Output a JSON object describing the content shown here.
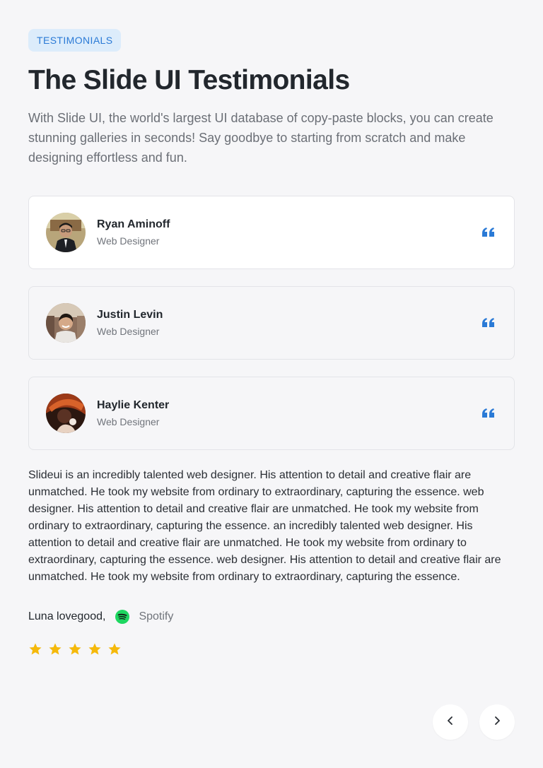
{
  "header": {
    "badge": "TESTIMONIALS",
    "title": "The Slide UI Testimonials",
    "description": "With Slide UI, the world's largest UI database of copy-paste blocks, you can create stunning galleries in seconds! Say goodbye to starting from scratch and make designing effortless and fun."
  },
  "testimonials": [
    {
      "name": "Ryan Aminoff",
      "role": "Web Designer",
      "avatar_icon": "person-avatar-1",
      "active": true
    },
    {
      "name": "Justin Levin",
      "role": "Web Designer",
      "avatar_icon": "person-avatar-2",
      "active": false
    },
    {
      "name": "Haylie Kenter",
      "role": "Web Designer",
      "avatar_icon": "person-avatar-3",
      "active": false
    }
  ],
  "review": {
    "text": "Slideui is an incredibly talented web designer. His attention to detail and creative flair are unmatched. He took my website from ordinary to extraordinary, capturing the essence. web designer. His attention to detail and creative flair are unmatched. He took my website from ordinary to extraordinary, capturing the essence. an incredibly talented web designer. His attention to detail and creative flair are unmatched. He took my website from ordinary to extraordinary, capturing the essence. web designer. His attention to detail and creative flair are unmatched. He took my website from ordinary to extraordinary, capturing the essence.",
    "author": "Luna lovegood,",
    "company": "Spotify",
    "company_icon": "spotify-icon",
    "rating": 5
  },
  "colors": {
    "accent": "#2a7ad6",
    "badge_bg": "#dcecfb",
    "star": "#f5b90b",
    "spotify": "#1ed760"
  },
  "navigation": {
    "prev_icon": "chevron-left-icon",
    "next_icon": "chevron-right-icon"
  }
}
